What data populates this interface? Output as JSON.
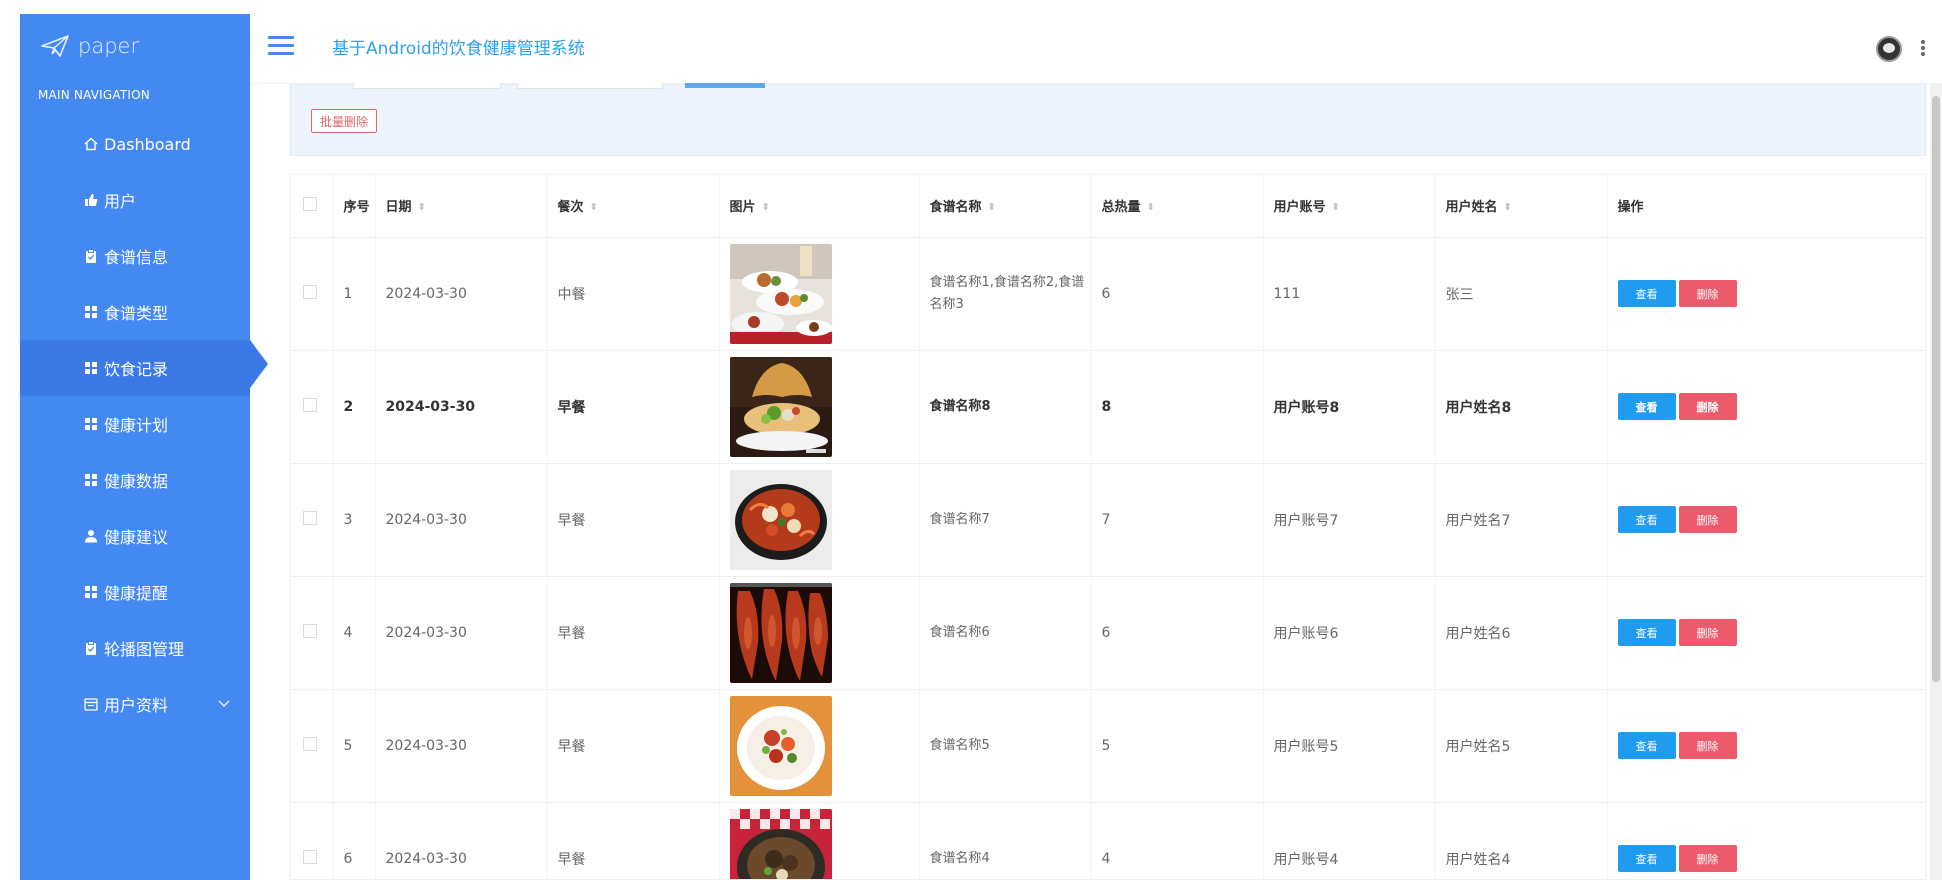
{
  "brand": {
    "name": "paper",
    "nav_title": "MAIN NAVIGATION"
  },
  "sidebar": {
    "items": [
      {
        "label": "Dashboard",
        "icon": "home-icon"
      },
      {
        "label": "用户",
        "icon": "thumb-icon"
      },
      {
        "label": "食谱信息",
        "icon": "clipboard-icon"
      },
      {
        "label": "食谱类型",
        "icon": "grid-icon"
      },
      {
        "label": "饮食记录",
        "icon": "grid-icon",
        "active": true
      },
      {
        "label": "健康计划",
        "icon": "grid-icon"
      },
      {
        "label": "健康数据",
        "icon": "grid-icon"
      },
      {
        "label": "健康建议",
        "icon": "user-icon"
      },
      {
        "label": "健康提醒",
        "icon": "grid-icon"
      },
      {
        "label": "轮播图管理",
        "icon": "clipboard-icon"
      },
      {
        "label": "用户资料",
        "icon": "calendar-icon",
        "expandable": true
      }
    ]
  },
  "header": {
    "title": "基于Android的饮食健康管理系统"
  },
  "toolbar": {
    "batch_delete": "批量删除"
  },
  "table": {
    "columns": [
      "序号",
      "日期",
      "餐次",
      "图片",
      "食谱名称",
      "总热量",
      "用户账号",
      "用户姓名",
      "操作"
    ],
    "actions": {
      "view": "查看",
      "delete": "删除"
    },
    "rows": [
      {
        "index": "1",
        "date": "2024-03-30",
        "meal": "中餐",
        "image": "plated-dishes",
        "recipe": "食谱名称1,食谱名称2,食谱名称3",
        "calories": "6",
        "account": "111",
        "name": "张三"
      },
      {
        "index": "2",
        "date": "2024-03-30",
        "meal": "早餐",
        "image": "salad-bowl",
        "recipe": "食谱名称8",
        "calories": "8",
        "account": "用户账号8",
        "name": "用户姓名8"
      },
      {
        "index": "3",
        "date": "2024-03-30",
        "meal": "早餐",
        "image": "seafood-pan",
        "recipe": "食谱名称7",
        "calories": "7",
        "account": "用户账号7",
        "name": "用户姓名7"
      },
      {
        "index": "4",
        "date": "2024-03-30",
        "meal": "早餐",
        "image": "roast-ducks",
        "recipe": "食谱名称6",
        "calories": "6",
        "account": "用户账号6",
        "name": "用户姓名6"
      },
      {
        "index": "5",
        "date": "2024-03-30",
        "meal": "早餐",
        "image": "plate-shrimp",
        "recipe": "食谱名称5",
        "calories": "5",
        "account": "用户账号5",
        "name": "用户姓名5"
      },
      {
        "index": "6",
        "date": "2024-03-30",
        "meal": "早餐",
        "image": "braised-meat",
        "recipe": "食谱名称4",
        "calories": "4",
        "account": "用户账号4",
        "name": "用户姓名4"
      }
    ]
  },
  "colors": {
    "sidebar": "#4488f2",
    "accent": "#2ea0f0",
    "view": "#1f9cf0",
    "delete": "#ec5b6c"
  }
}
